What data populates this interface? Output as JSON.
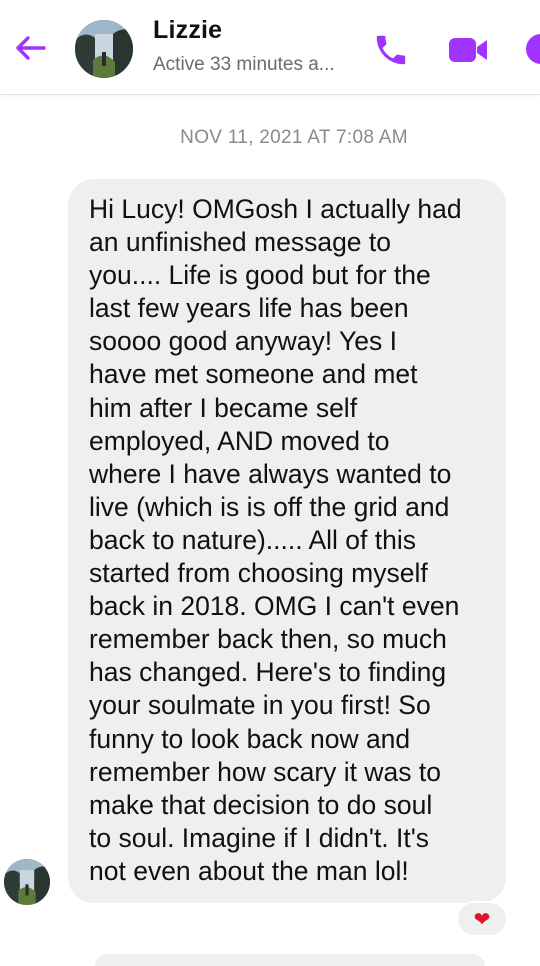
{
  "header": {
    "contact_name": "Lizzie",
    "status": "Active 33 minutes a...",
    "icons": {
      "back": "arrow-left-icon",
      "call": "phone-icon",
      "video": "video-camera-icon",
      "info": "info-icon"
    }
  },
  "conversation": {
    "timestamp": "NOV 11, 2021 AT 7:08 AM",
    "message": {
      "lines": [
        "Hi Lucy! OMGosh I actually had",
        "an unfinished message to",
        "you.... Life is good but for the",
        "last few years life has been",
        "soooo good anyway! Yes I",
        "have met someone and met",
        "him after I became self",
        "employed, AND moved to",
        "where I have always wanted to",
        "live (which is is off the grid and",
        "back to nature)..... All of this",
        "started from choosing myself",
        "back in 2018. OMG I can't even",
        "remember back then, so much",
        "has changed. Here's to finding",
        "your soulmate in you first! So",
        "funny to look back now and",
        "remember how scary it was to",
        "make that decision to do soul",
        "to soul. Imagine if I didn't. It's",
        "not even about the man lol!"
      ],
      "reaction": "❤"
    }
  },
  "colors": {
    "accent": "#a033ff",
    "bubble": "#efefef",
    "reaction": "#e0142b"
  }
}
